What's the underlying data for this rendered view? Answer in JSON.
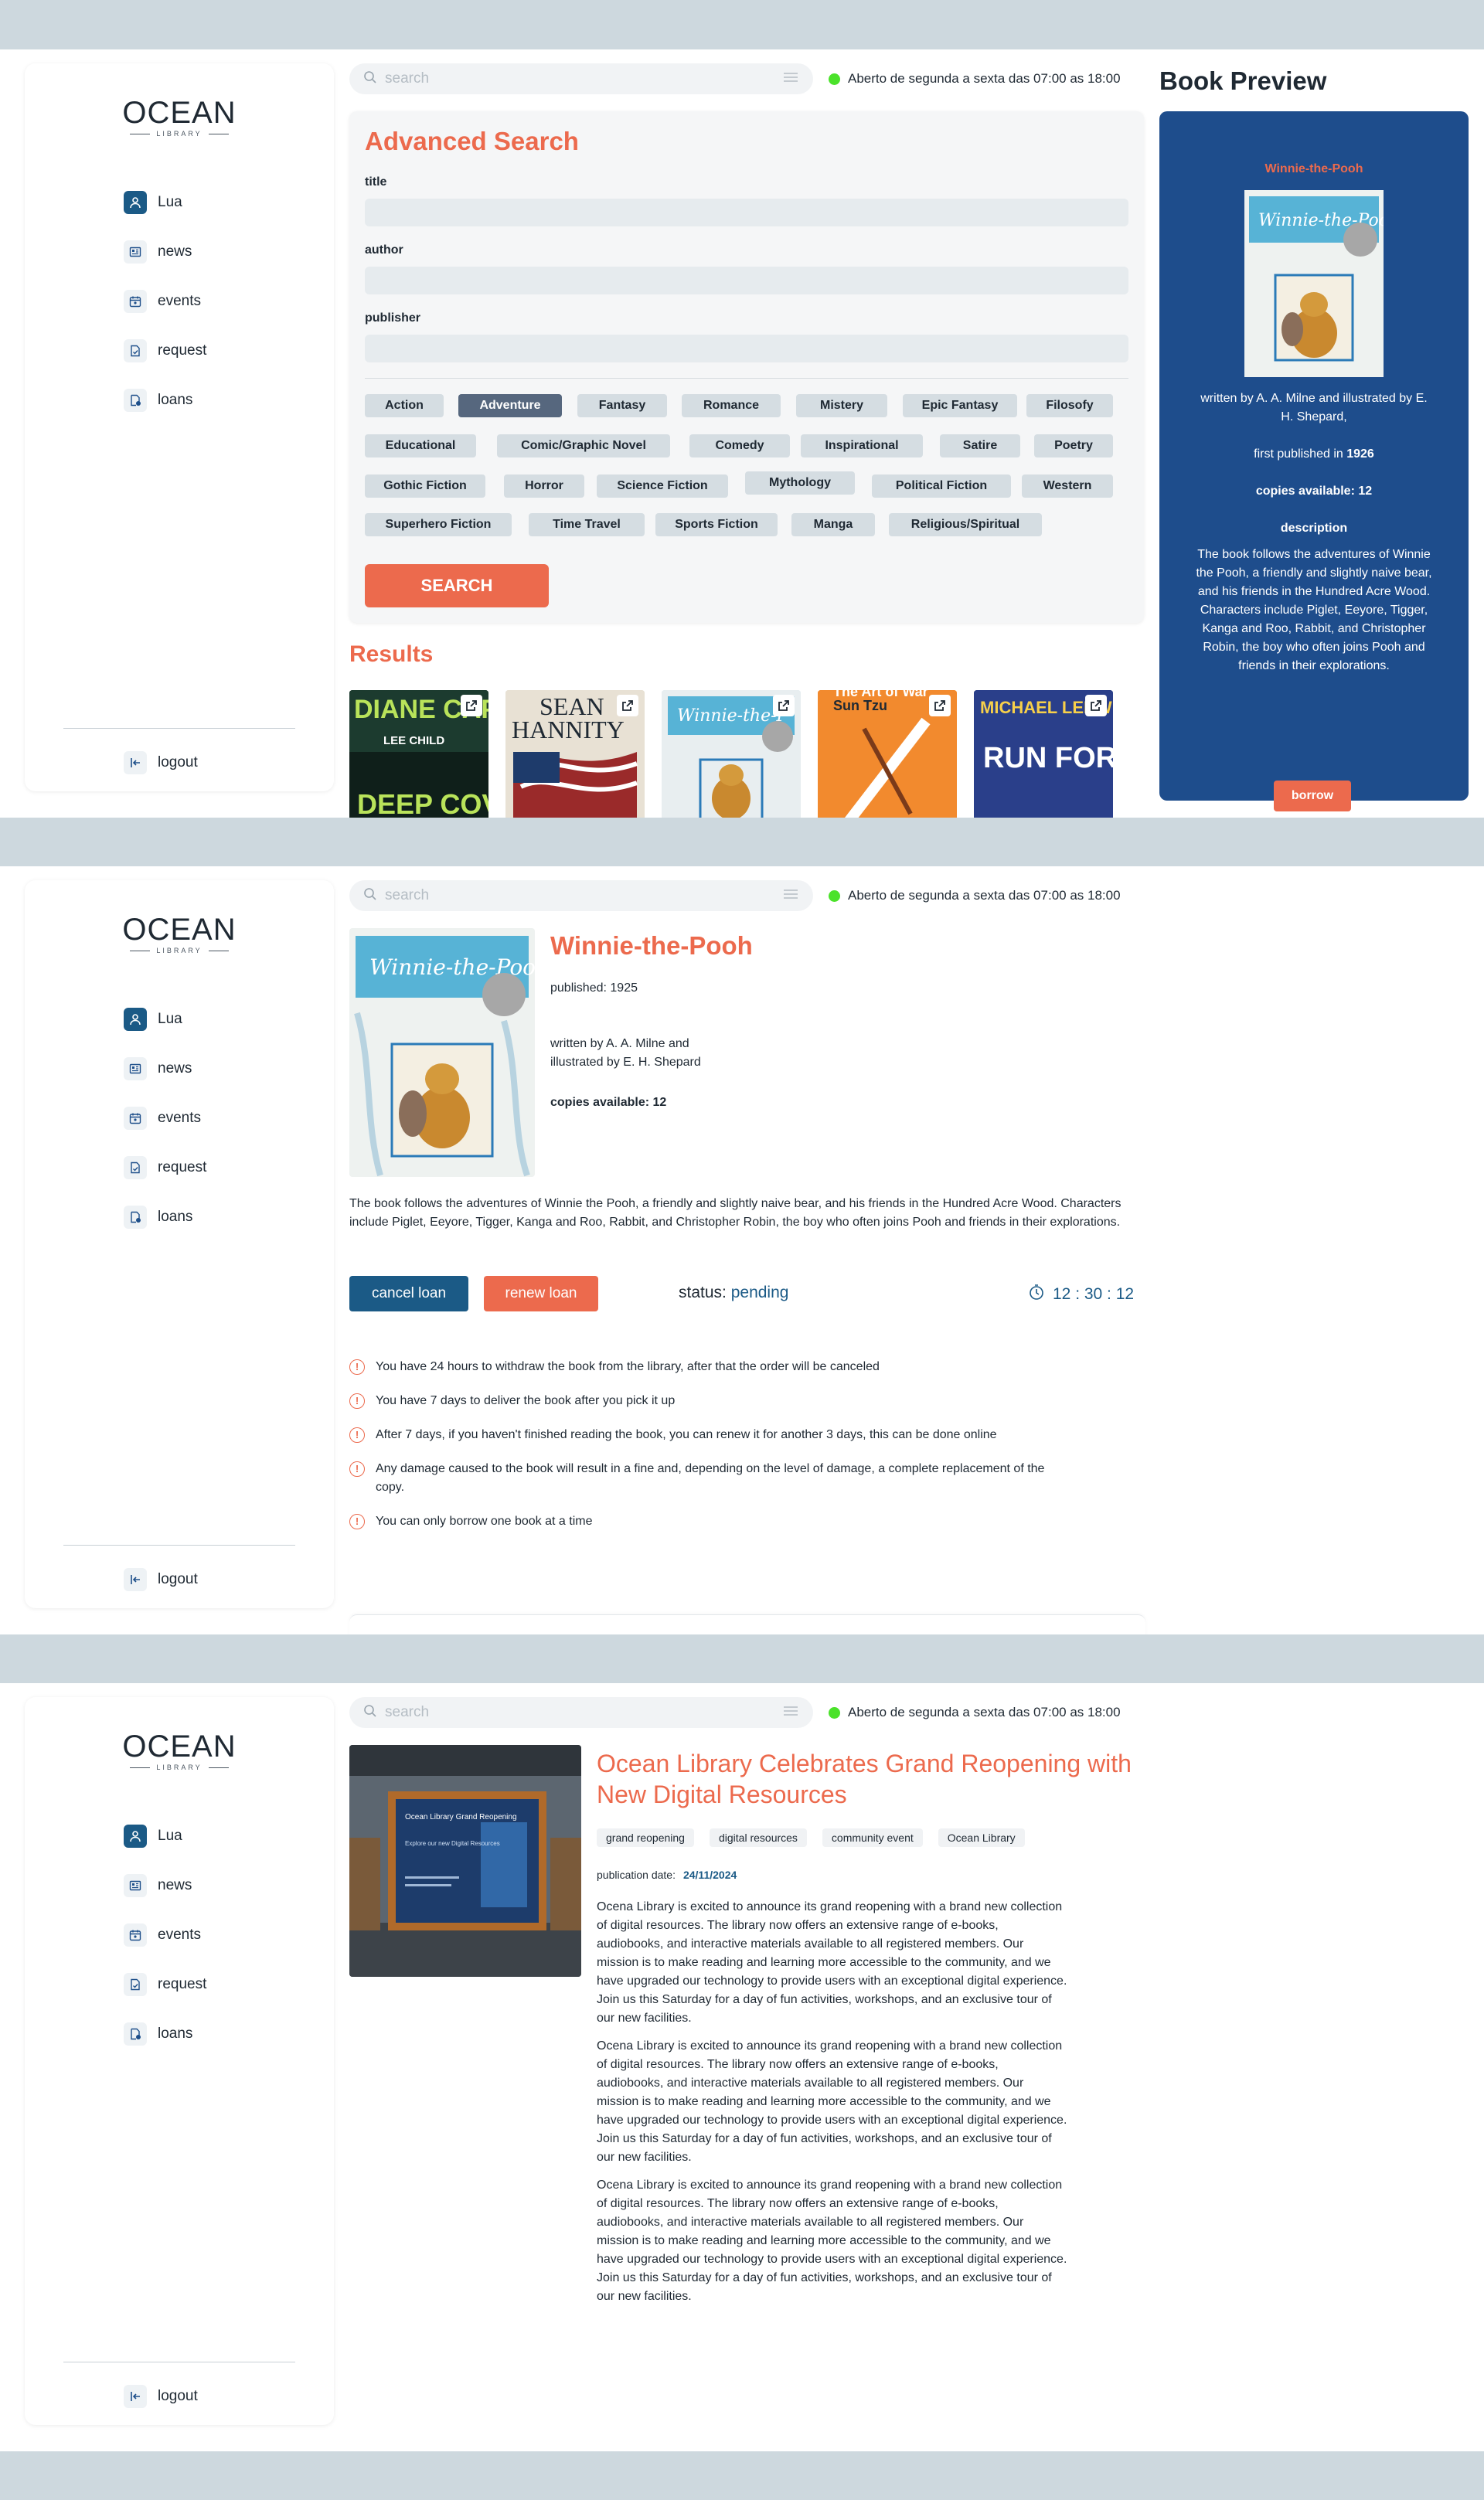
{
  "app": {
    "logo_main": "OCEAN",
    "logo_sub": "LIBRARY",
    "nav": [
      {
        "label": "Lua",
        "icon": "user-icon"
      },
      {
        "label": "news",
        "icon": "newspaper-icon"
      },
      {
        "label": "events",
        "icon": "calendar-icon"
      },
      {
        "label": "request",
        "icon": "document-icon"
      },
      {
        "label": "loans",
        "icon": "loan-icon"
      }
    ],
    "logout_label": "logout",
    "search_placeholder": "search",
    "opening_hours": "Aberto de segunda a sexta das 07:00 as 18:00"
  },
  "search_page": {
    "title": "Advanced Search",
    "fields": [
      {
        "label": "title",
        "value": ""
      },
      {
        "label": "author",
        "value": ""
      },
      {
        "label": "publisher",
        "value": ""
      }
    ],
    "genres": [
      [
        "Action",
        "Adventure",
        "Fantasy",
        "Romance",
        "Mistery",
        "Epic Fantasy",
        "Filosofy"
      ],
      [
        "Educational",
        "Comic/Graphic Novel",
        "Comedy",
        "Inspirational",
        "Satire",
        "Poetry"
      ],
      [
        "Gothic Fiction",
        "Horror",
        "Science Fiction",
        "Mythology",
        "Political Fiction",
        "Western"
      ],
      [
        "Superhero Fiction",
        "Time Travel",
        "Sports Fiction",
        "Manga",
        "Religious/Spiritual"
      ]
    ],
    "active_genre": "Adventure",
    "search_button": "SEARCH",
    "results_title": "Results",
    "results": [
      {
        "title_text": "DIANE CAP",
        "author_text": "LEE CHILD",
        "sub_text": "DEEP COVER",
        "bg": "#1c3b2f"
      },
      {
        "title_text": "SEAN",
        "author_text": "HANNITY",
        "sub_text": "",
        "bg": "#e8e1d4"
      },
      {
        "title_text": "Winnie-the-P",
        "author_text": "",
        "sub_text": "",
        "bg": "#cfe6f0"
      },
      {
        "title_text": "The Art of War",
        "author_text": "Sun Tzu",
        "sub_text": "",
        "bg": "#f28a2e"
      },
      {
        "title_text": "MICHAEL LEDWI",
        "author_text": "",
        "sub_text": "RUN FOR COVER",
        "bg": "#2a3f8a"
      }
    ],
    "preview": {
      "heading": "Book Preview",
      "book_title": "Winnie-the-Pooh",
      "written_by": "written by A. A. Milne and illustrated by E. H. Shepard,",
      "first_published_prefix": "first published in",
      "first_published_year": "1926",
      "copies": "copies available: 12",
      "description_label": "description",
      "description": "The book follows the adventures of Winnie the Pooh, a friendly and slightly naive bear, and his friends in the Hundred Acre Wood. Characters include Piglet, Eeyore, Tigger, Kanga and Roo, Rabbit, and Christopher Robin, the boy who often joins Pooh and friends in their explorations.",
      "borrow_button": "borrow"
    }
  },
  "loan_page": {
    "cover_title": "Winnie-the-Pooh",
    "title": "Winnie-the-Pooh",
    "published": "published: 1925",
    "written_by": "written by A. A. Milne and illustrated by E. H. Shepard",
    "copies": "copies available: 12",
    "description": "The book follows the adventures of Winnie the Pooh, a friendly and slightly naive bear, and his friends in the Hundred Acre Wood. Characters include Piglet, Eeyore, Tigger, Kanga and Roo, Rabbit, and Christopher Robin, the boy who often joins Pooh and friends in their explorations.",
    "cancel_button": "cancel loan",
    "renew_button": "renew loan",
    "status_label": "status:",
    "status_value": "pending",
    "timer": "12 : 30 : 12",
    "rules": [
      "You have 24 hours to withdraw the book from the library, after that the order will be canceled",
      "You have 7 days to deliver the book after you pick it up",
      "After 7 days, if you haven't finished reading the book, you can renew it for another 3 days, this can be done online",
      "Any damage caused to the book will result in a fine and, depending on the level of damage, a complete replacement of the copy.",
      "You can only borrow one book at a time"
    ]
  },
  "news_page": {
    "image_heading": "Ocean Library Grand Reopening",
    "image_subheading": "Explore our new Digital Resources",
    "title": "Ocean Library Celebrates Grand Reopening with New Digital Resources",
    "tags": [
      "grand reopening",
      "digital resources",
      "community event",
      "Ocean Library"
    ],
    "date_label": "publication date:",
    "date_value": "24/11/2024",
    "paragraphs": [
      "Ocena Library is excited to announce its grand reopening with a brand new collection of digital resources. The library now offers an extensive range of e-books, audiobooks, and interactive materials available to all registered members. Our mission is to make reading and learning more accessible to the community, and we have upgraded our technology to provide users with an exceptional digital experience. Join us this Saturday for a day of fun activities, workshops, and an exclusive tour of our new facilities.",
      "Ocena Library is excited to announce its grand reopening with a brand new collection of digital resources. The library now offers an extensive range of e-books, audiobooks, and interactive materials available to all registered members. Our mission is to make reading and learning more accessible to the community, and we have upgraded our technology to provide users with an exceptional digital experience. Join us this Saturday for a day of fun activities, workshops, and an exclusive tour of our new facilities.",
      "Ocena Library is excited to announce its grand reopening with a brand new collection of digital resources. The library now offers an extensive range of e-books, audiobooks, and interactive materials available to all registered members. Our mission is to make reading and learning more accessible to the community, and we have upgraded our technology to provide users with an exceptional digital experience. Join us this Saturday for a day of fun activities, workshops, and an exclusive tour of our new facilities."
    ]
  },
  "colors": {
    "accent": "#ec6a4d",
    "primary": "#1b5a86",
    "preview_bg": "#1e4d8c",
    "status_open": "#4be22a",
    "page_bg": "#cdd8de"
  }
}
